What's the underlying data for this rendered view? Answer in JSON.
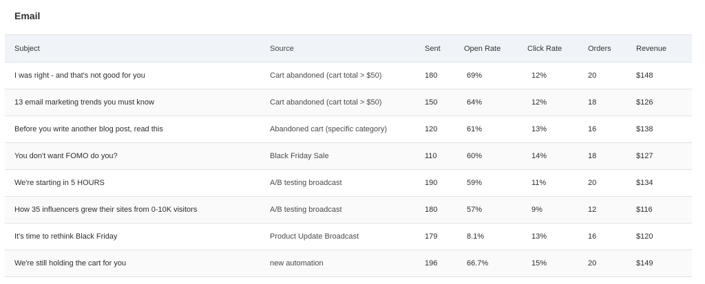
{
  "section": {
    "title": "Email"
  },
  "table": {
    "columns": [
      "Subject",
      "Source",
      "Sent",
      "Open Rate",
      "Click Rate",
      "Orders",
      "Revenue"
    ],
    "rows": [
      [
        "I was right - and that's not good for you",
        "Cart abandoned (cart total > $50)",
        "180",
        "69%",
        "12%",
        "20",
        "$148"
      ],
      [
        "13 email marketing trends you must know",
        "Cart abandoned (cart total > $50)",
        "150",
        "64%",
        "12%",
        "18",
        "$126"
      ],
      [
        "Before you write another blog post, read this",
        "Abandoned cart (specific category)",
        "120",
        "61%",
        "13%",
        "16",
        "$138"
      ],
      [
        "You don't want FOMO do you?",
        "Black Friday Sale",
        "110",
        "60%",
        "14%",
        "18",
        "$127"
      ],
      [
        "We're starting in 5 HOURS",
        "A/B testing broadcast",
        "190",
        "59%",
        "11%",
        "20",
        "$134"
      ],
      [
        "How 35 influencers grew their sites from 0-10K visitors",
        "A/B testing broadcast",
        "180",
        "57%",
        "9%",
        "12",
        "$116"
      ],
      [
        "It's time to rethink Black Friday",
        "Product Update Broadcast",
        "179",
        "8.1%",
        "13%",
        "16",
        "$120"
      ],
      [
        "We're still holding the cart for you",
        "new automation",
        "196",
        "66.7%",
        "15%",
        "20",
        "$149"
      ]
    ]
  }
}
